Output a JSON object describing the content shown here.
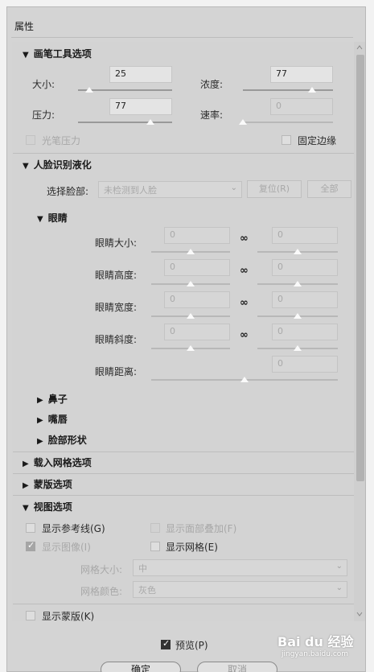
{
  "panel": {
    "title": "属性"
  },
  "brush": {
    "header": "画笔工具选项",
    "size_label": "大小:",
    "size_value": "25",
    "size_level": 0.12,
    "density_label": "浓度:",
    "density_value": "77",
    "density_level": 0.77,
    "pressure_label": "压力:",
    "pressure_value": "77",
    "pressure_level": 0.77,
    "rate_label": "速率:",
    "rate_value": "0",
    "rate_level": 0.0,
    "stylus_label": "光笔压力",
    "pin_edges_label": "固定边缘"
  },
  "face": {
    "header": "人脸识别液化",
    "select_label": "选择脸部:",
    "select_value": "未检测到人脸",
    "reset_label": "复位(R)",
    "all_label": "全部",
    "eyes": {
      "header": "眼睛",
      "rows": [
        {
          "label": "眼睛大小:",
          "left": "0",
          "right": "0",
          "linked": true
        },
        {
          "label": "眼睛高度:",
          "left": "0",
          "right": "0",
          "linked": true
        },
        {
          "label": "眼睛宽度:",
          "left": "0",
          "right": "0",
          "linked": true
        },
        {
          "label": "眼睛斜度:",
          "left": "0",
          "right": "0",
          "linked": true
        },
        {
          "label": "眼睛距离:",
          "right": "0"
        }
      ]
    },
    "nose": "鼻子",
    "mouth": "嘴唇",
    "face_shape": "脸部形状"
  },
  "load_mesh": "载入网格选项",
  "mask": "蒙版选项",
  "view": {
    "header": "视图选项",
    "show_guides": "显示参考线(G)",
    "show_face_overlay": "显示面部叠加(F)",
    "show_image": "显示图像(I)",
    "show_mesh": "显示网格(E)",
    "mesh_size_label": "网格大小:",
    "mesh_size_value": "中",
    "mesh_color_label": "网格颜色:",
    "mesh_color_value": "灰色"
  },
  "show_mask": "显示蒙版(K)",
  "preview": "预览(P)",
  "ok": "确定",
  "cancel": "取消",
  "watermark": {
    "brand": "Bai du 经验",
    "url": "jingyan.baidu.com"
  },
  "colors": {
    "panel": "#d3d3d3",
    "checked": "#333333"
  }
}
